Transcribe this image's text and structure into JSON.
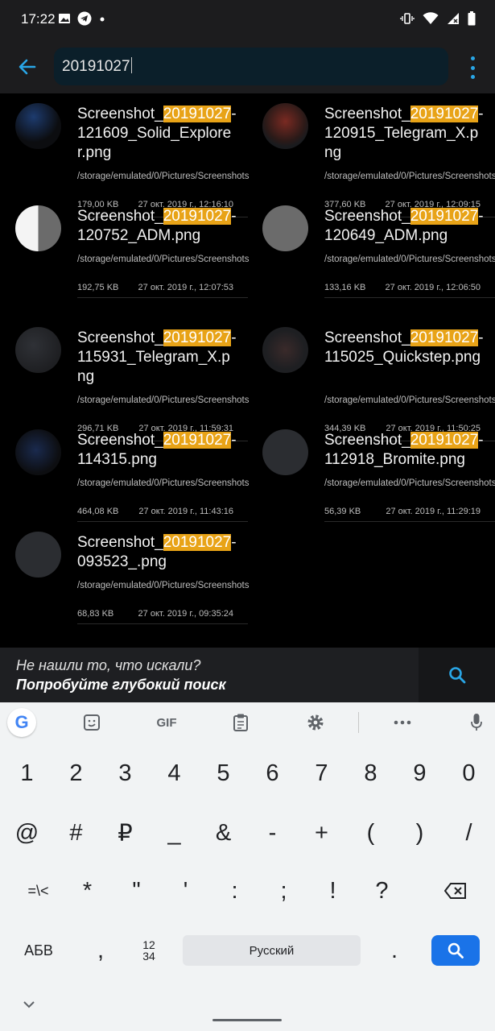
{
  "status_bar": {
    "time": "17:22",
    "left_icons": [
      "image-icon",
      "telegram-icon",
      "dot-icon"
    ],
    "right_icons": [
      "vibrate-icon",
      "wifi-icon",
      "signal-icon",
      "battery-icon"
    ]
  },
  "search": {
    "value": "20191027",
    "accent_color": "#29a6e6"
  },
  "results": [
    {
      "name_prefix": "Screenshot_",
      "highlight": "20191027",
      "name_suffix": "-121609_Solid_Explorer.png",
      "path": "/storage/emulated/0/Pictures/Screenshots",
      "size": "179,00 KB",
      "date": "27 окт. 2019 г., 12:16:10"
    },
    {
      "name_prefix": "Screenshot_",
      "highlight": "20191027",
      "name_suffix": "-120915_Telegram_X.png",
      "path": "/storage/emulated/0/Pictures/Screenshots",
      "size": "377,60 KB",
      "date": "27 окт. 2019 г., 12:09:15"
    },
    {
      "name_prefix": "Screenshot_",
      "highlight": "20191027",
      "name_suffix": "-120752_ADM.png",
      "path": "/storage/emulated/0/Pictures/Screenshots",
      "size": "192,75 KB",
      "date": "27 окт. 2019 г., 12:07:53"
    },
    {
      "name_prefix": "Screenshot_",
      "highlight": "20191027",
      "name_suffix": "-120649_ADM.png",
      "path": "/storage/emulated/0/Pictures/Screenshots",
      "size": "133,16 KB",
      "date": "27 окт. 2019 г., 12:06:50"
    },
    {
      "name_prefix": "Screenshot_",
      "highlight": "20191027",
      "name_suffix": "-115931_Telegram_X.png",
      "path": "/storage/emulated/0/Pictures/Screenshots",
      "size": "296,71 KB",
      "date": "27 окт. 2019 г., 11:59:31"
    },
    {
      "name_prefix": "Screenshot_",
      "highlight": "20191027",
      "name_suffix": "-115025_Quickstep.png",
      "path": "/storage/emulated/0/Pictures/Screenshots",
      "size": "344,39 KB",
      "date": "27 окт. 2019 г., 11:50:25"
    },
    {
      "name_prefix": "Screenshot_",
      "highlight": "20191027",
      "name_suffix": "-114315.png",
      "path": "/storage/emulated/0/Pictures/Screenshots",
      "size": "464,08 KB",
      "date": "27 окт. 2019 г., 11:43:16"
    },
    {
      "name_prefix": "Screenshot_",
      "highlight": "20191027",
      "name_suffix": "-112918_Bromite.png",
      "path": "/storage/emulated/0/Pictures/Screenshots",
      "size": "56,39 KB",
      "date": "27 окт. 2019 г., 11:29:19"
    },
    {
      "name_prefix": "Screenshot_",
      "highlight": "20191027",
      "name_suffix": "-093523_.png",
      "path": "/storage/emulated/0/Pictures/Screenshots",
      "size": "68,83 KB",
      "date": "27 окт. 2019 г., 09:35:24"
    }
  ],
  "deep_search": {
    "question": "Не нашли то, что искали?",
    "action": "Попробуйте глубокий поиск"
  },
  "keyboard": {
    "toolbar": {
      "gif_label": "GIF",
      "google_label": "G"
    },
    "row1": [
      "1",
      "2",
      "3",
      "4",
      "5",
      "6",
      "7",
      "8",
      "9",
      "0"
    ],
    "row2": [
      "@",
      "#",
      "₽",
      "_",
      "&",
      "-",
      "+",
      "(",
      ")",
      "/"
    ],
    "row3": [
      "=\\<",
      "*",
      "\"",
      "'",
      ":",
      ";",
      "!",
      "?"
    ],
    "row4": {
      "abc": "АБВ",
      "comma": ",",
      "numpad_top": "12",
      "numpad_bottom": "34",
      "space": "Русский",
      "period": "."
    },
    "search_key_color": "#1a73e8"
  }
}
